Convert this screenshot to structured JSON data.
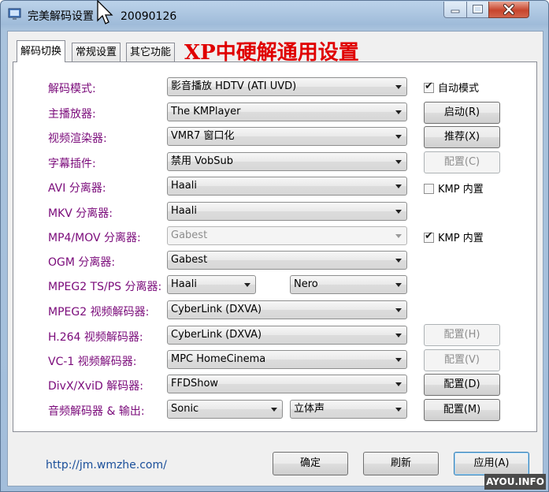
{
  "window": {
    "title": "完美解码设置",
    "version": "20090126",
    "controls": {
      "minimize": "minimize-icon",
      "maximize": "maximize-icon",
      "close": "close-icon"
    }
  },
  "tabs": [
    {
      "label": "解码切换",
      "active": true
    },
    {
      "label": "常规设置",
      "active": false
    },
    {
      "label": "其它功能",
      "active": false
    }
  ],
  "heading": "XP中硬解通用设置",
  "rows": [
    {
      "label": "解码模式:",
      "value": "影音播放 HDTV (ATI UVD)"
    },
    {
      "label": "主播放器:",
      "value": "The KMPlayer"
    },
    {
      "label": "视频渲染器:",
      "value": "VMR7 窗口化"
    },
    {
      "label": "字幕插件:",
      "value": "禁用 VobSub"
    },
    {
      "label": "AVI 分离器:",
      "value": "Haali"
    },
    {
      "label": "MKV 分离器:",
      "value": "Haali"
    },
    {
      "label": "MP4/MOV 分离器:",
      "value": "Gabest"
    },
    {
      "label": "OGM 分离器:",
      "value": "Gabest"
    },
    {
      "label": "MPEG2 TS/PS 分离器:",
      "value": "Haali",
      "value2": "Nero"
    },
    {
      "label": "MPEG2 视频解码器:",
      "value": "CyberLink (DXVA)"
    },
    {
      "label": "H.264 视频解码器:",
      "value": "CyberLink (DXVA)"
    },
    {
      "label": "VC-1 视频解码器:",
      "value": "MPC HomeCinema"
    },
    {
      "label": "DivX/XviD 解码器:",
      "value": "FFDShow"
    },
    {
      "label": "音频解码器 & 输出:",
      "value": "Sonic",
      "value2": "立体声"
    }
  ],
  "side": {
    "auto_mode": {
      "label": "自动模式",
      "checked": true
    },
    "start_button": "启动(R)",
    "recommend_button": "推荐(X)",
    "config_c": "配置(C)",
    "avi_kmp": {
      "label": "KMP 内置",
      "checked": false
    },
    "mp4_kmp": {
      "label": "KMP 内置",
      "checked": true
    },
    "config_h": "配置(H)",
    "config_v": "配置(V)",
    "config_d": "配置(D)",
    "config_m": "配置(M)"
  },
  "footer": {
    "url": "http://jm.wmzhe.com/",
    "ok_button": "确定",
    "refresh_button": "刷新",
    "apply_button": "应用(A)"
  },
  "watermark": "AYOU.INFO",
  "colors": {
    "label": "#7a0a7a",
    "heading": "#e00000",
    "link": "#1a4f9a"
  }
}
